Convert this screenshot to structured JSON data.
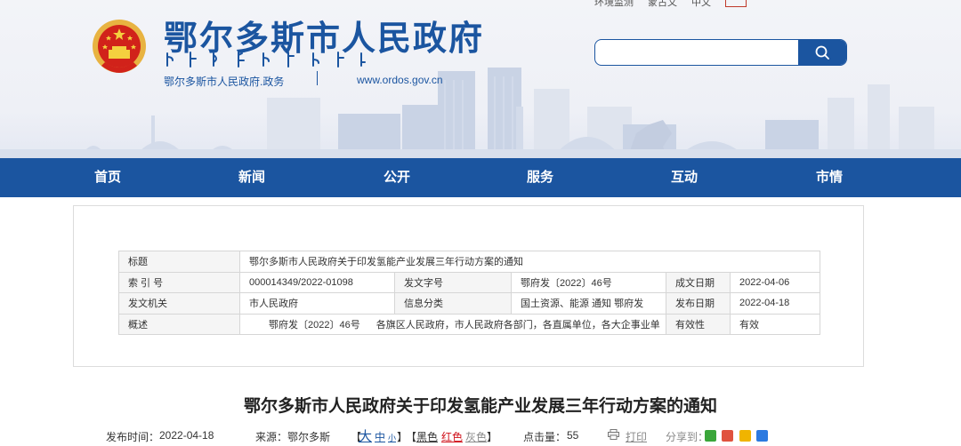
{
  "header": {
    "site_title": "鄂尔多斯市人民政府",
    "subtitle": "鄂尔多斯市人民政府.政务",
    "url": "www.ordos.gov.cn",
    "top_links": [
      "环境监测",
      "蒙古文",
      "中文"
    ],
    "search": {
      "value": "",
      "placeholder": ""
    }
  },
  "nav": {
    "items": [
      "首页",
      "新闻",
      "公开",
      "服务",
      "互动",
      "市情"
    ]
  },
  "info": {
    "title_label": "标题",
    "title_value": "鄂尔多斯市人民政府关于印发氢能产业发展三年行动方案的通知",
    "index_label": "索 引 号",
    "index_value": "000014349/2022-01098",
    "docno_label": "发文字号",
    "docno_value": "鄂府发〔2022〕46号",
    "date_label": "成文日期",
    "date_value": "2022-04-06",
    "issuer_label": "发文机关",
    "issuer_value": "市人民政府",
    "category_label": "信息分类",
    "category_value": "国土资源、能源 通知 鄂府发",
    "pubdate_label": "发布日期",
    "pubdate_value": "2022-04-18",
    "abstract_label": "概述",
    "abstract_docno": "鄂府发〔2022〕46号",
    "abstract_text": "各旗区人民政府，市人民政府各部门，各直属单位，各大企事业单",
    "validity_label": "有效性",
    "validity_value": "有效"
  },
  "article": {
    "title": "鄂尔多斯市人民政府关于印发氢能产业发展三年行动方案的通知",
    "pub_label": "发布时间：",
    "pub_value": "2022-04-18",
    "source_label": "来源：",
    "source_value": "鄂尔多斯",
    "bracket_open": "【",
    "bracket_close": "】",
    "size_big": "大",
    "size_mid": "中",
    "size_small": "小",
    "color_black": "黑色",
    "color_red": "红色",
    "color_gray": "灰色",
    "hits_label": "点击量：",
    "hits_value": "55",
    "print_label": "打印",
    "share_label": "分享到："
  },
  "colors": {
    "brand_blue": "#1b55a0",
    "nav_bg": "#1b55a0",
    "accent_red": "#d0121b"
  }
}
